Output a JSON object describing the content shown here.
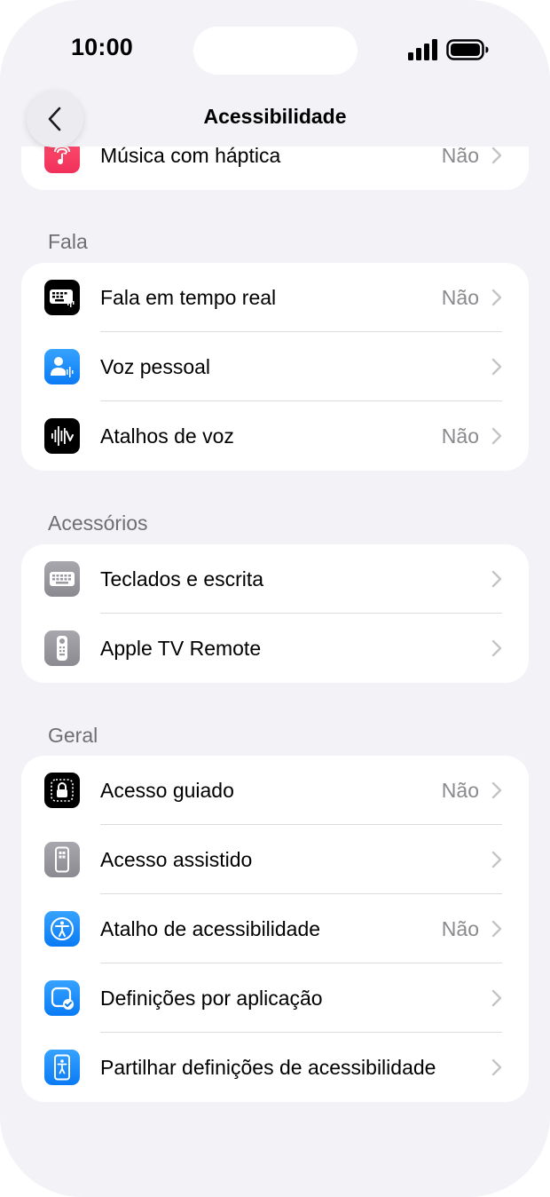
{
  "status_bar": {
    "time": "10:00"
  },
  "nav": {
    "title": "Acessibilidade"
  },
  "partial_row": {
    "label": "Música com háptica",
    "value": "Não",
    "icon": "music-haptics-icon"
  },
  "sections": {
    "fala": {
      "header": "Fala",
      "items": [
        {
          "label": "Fala em tempo real",
          "value": "Não",
          "icon": "keyboard-speech-icon"
        },
        {
          "label": "Voz pessoal",
          "value": "",
          "icon": "personal-voice-icon"
        },
        {
          "label": "Atalhos de voz",
          "value": "Não",
          "icon": "waveform-icon"
        }
      ]
    },
    "acessorios": {
      "header": "Acessórios",
      "items": [
        {
          "label": "Teclados e escrita",
          "value": "",
          "icon": "keyboard-icon"
        },
        {
          "label": "Apple TV Remote",
          "value": "",
          "icon": "remote-icon"
        }
      ]
    },
    "geral": {
      "header": "Geral",
      "items": [
        {
          "label": "Acesso guiado",
          "value": "Não",
          "icon": "guided-access-lock-icon"
        },
        {
          "label": "Acesso assistido",
          "value": "",
          "icon": "assistive-access-icon"
        },
        {
          "label": "Atalho de acessibilidade",
          "value": "Não",
          "icon": "accessibility-icon"
        },
        {
          "label": "Definições por aplicação",
          "value": "",
          "icon": "app-settings-icon"
        },
        {
          "label": "Partilhar definições de acessibilidade",
          "value": "",
          "icon": "share-accessibility-icon"
        }
      ]
    }
  }
}
